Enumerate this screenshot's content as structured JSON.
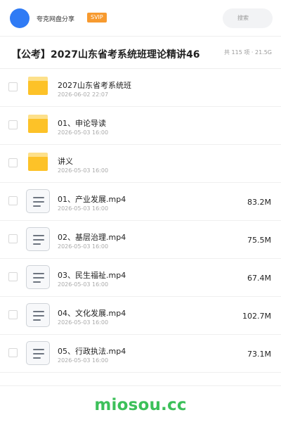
{
  "header": {
    "site_name": "夸克网盘分享",
    "badge": "SVIP",
    "search_placeholder": "搜索",
    "accent": "#2f7bf5",
    "badge_color": "#f79a2f"
  },
  "share": {
    "title": "【公考】2027山东省考系统班理论精讲46",
    "meta": "共 115 项 · 21.5G"
  },
  "files": [
    {
      "type": "folder",
      "icon": "folder-icon",
      "name": "2027山东省考系统班",
      "date": "2026-06-02 22:07",
      "size": ""
    },
    {
      "type": "folder",
      "icon": "folder-icon",
      "name": "01、申论导读",
      "date": "2026-05-03 16:00",
      "size": ""
    },
    {
      "type": "folder",
      "icon": "folder-icon",
      "name": "讲义",
      "date": "2026-05-03 16:00",
      "size": ""
    },
    {
      "type": "file",
      "icon": "document-icon",
      "name": "01、产业发展.mp4",
      "date": "2026-05-03 16:00",
      "size": "83.2M"
    },
    {
      "type": "file",
      "icon": "document-icon",
      "name": "02、基层治理.mp4",
      "date": "2026-05-03 16:00",
      "size": "75.5M"
    },
    {
      "type": "file",
      "icon": "document-icon",
      "name": "03、民生福祉.mp4",
      "date": "2026-05-03 16:00",
      "size": "67.4M"
    },
    {
      "type": "file",
      "icon": "document-icon",
      "name": "04、文化发展.mp4",
      "date": "2026-05-03 16:00",
      "size": "102.7M"
    },
    {
      "type": "file",
      "icon": "document-icon",
      "name": "05、行政执法.mp4",
      "date": "2026-05-03 16:00",
      "size": "73.1M"
    }
  ],
  "footer": {
    "brand": "miosou.cc",
    "brand_color": "#3cc05a"
  }
}
